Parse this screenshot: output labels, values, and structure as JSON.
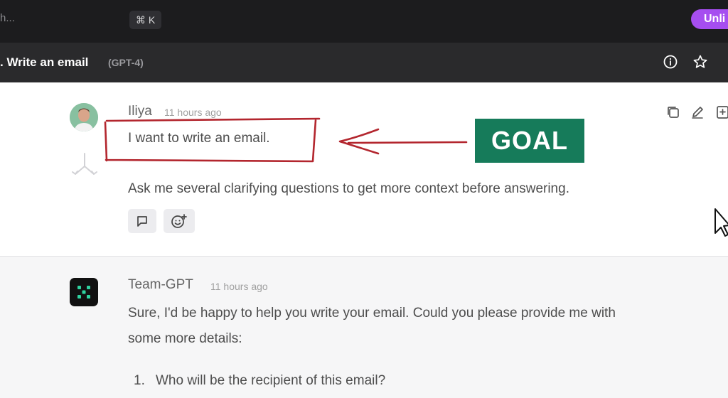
{
  "topbar": {
    "search_text": "h...",
    "shortcut": "⌘ K",
    "upgrade_label": "Unli"
  },
  "chat": {
    "title": ". Write an email",
    "model": "(GPT-4)"
  },
  "user_message": {
    "author": "Iliya",
    "time": "11 hours ago",
    "line1": "I want to write an email.",
    "line2": "Ask me several clarifying questions to get more context before answering."
  },
  "annotation": {
    "goal_label": "GOAL",
    "colors": {
      "box": "#b3262e",
      "goal_bg": "#167b5a"
    }
  },
  "assistant_message": {
    "author": "Team-GPT",
    "time": "11 hours ago",
    "line1": "Sure, I'd be happy to help you write your email. Could you please provide me with",
    "line2": "some more details:",
    "list": [
      {
        "num": "1.",
        "text": "Who will be the recipient of this email?"
      }
    ]
  },
  "icons": [
    "info-icon",
    "star-icon",
    "copy-icon",
    "edit-icon",
    "bookmark-add-icon",
    "branch-icon",
    "comment-icon",
    "add-reaction-icon",
    "mouse-cursor-icon",
    "team-gpt-logo-icon"
  ],
  "colors": {
    "accent": "#a64ef0",
    "topbar": "#1c1c1e",
    "titlebar": "#2a2a2c"
  }
}
